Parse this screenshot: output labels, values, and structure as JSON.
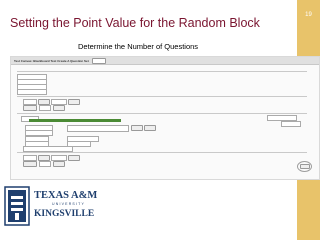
{
  "slide": {
    "number": "19",
    "title": "Setting the Point Value for the Random Block",
    "subtitle": "Determine the Number of Questions"
  },
  "screenshot": {
    "header_title": "Test Canvas: Blackboard Test Create A Question Set"
  },
  "logo": {
    "line1": "TEXAS A&M",
    "line2": "UNIVERSITY",
    "line3": "KINGSVILLE"
  },
  "colors": {
    "title": "#7a1530",
    "accent_bar": "#e8c36a",
    "green_banner": "#4a8a34",
    "logo_blue": "#1f3f6e"
  }
}
